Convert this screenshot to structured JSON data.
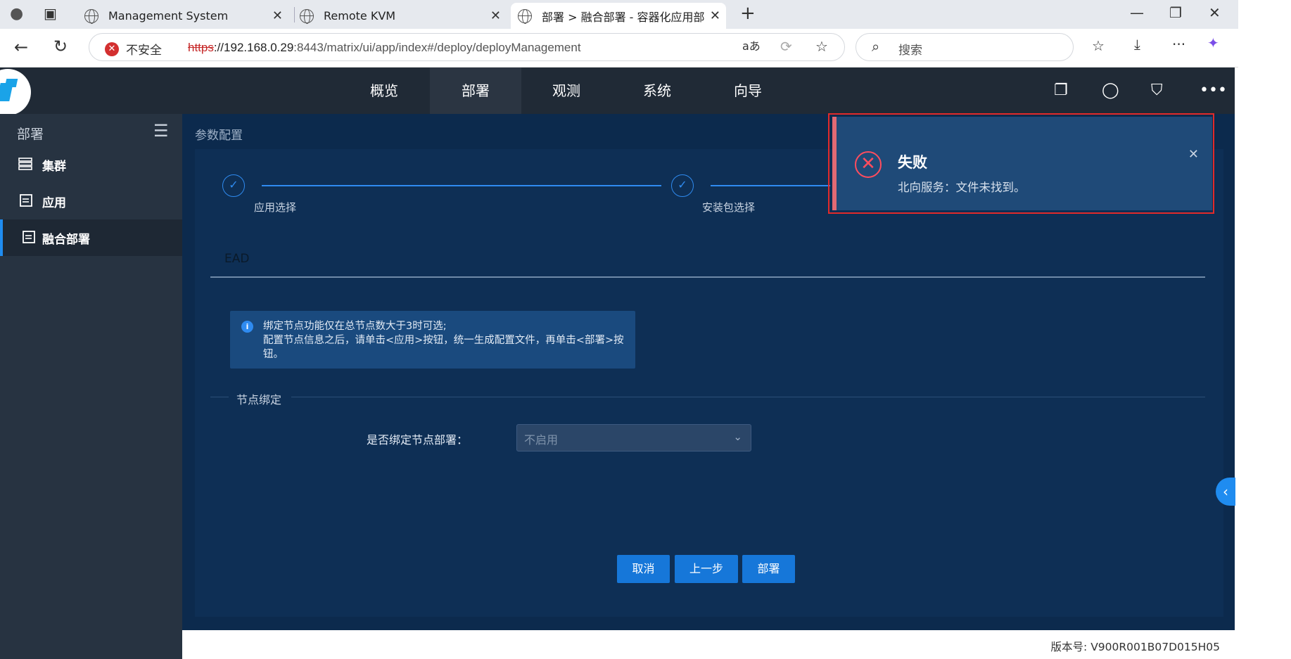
{
  "browser": {
    "tabs": [
      {
        "title": "Management System"
      },
      {
        "title": "Remote KVM"
      },
      {
        "title": "部署 > 融合部署 - 容器化应用部署"
      }
    ],
    "insecure_label": "不安全",
    "url_scheme": "https",
    "url_host": "://192.168.0.29",
    "url_rest": ":8443/matrix/ui/app/index#/deploy/deployManagement",
    "search_placeholder": "搜索"
  },
  "topnav": {
    "items": [
      {
        "label": "概览"
      },
      {
        "label": "部署"
      },
      {
        "label": "观测"
      },
      {
        "label": "系统"
      },
      {
        "label": "向导"
      }
    ]
  },
  "sidebar": {
    "title": "部署",
    "items": [
      {
        "label": "集群"
      },
      {
        "label": "应用"
      },
      {
        "label": "融合部署"
      }
    ]
  },
  "main": {
    "breadcrumb": "参数配置",
    "steps": [
      {
        "label": "应用选择",
        "icon": "check-icon"
      },
      {
        "label": "安装包选择",
        "icon": "check-icon"
      }
    ],
    "tab": "EAD",
    "info": {
      "line1": "绑定节点功能仅在总节点数大于3时可选;",
      "line2": "配置节点信息之后，请单击<应用>按钮，统一生成配置文件，再单击<部署>按钮。"
    },
    "section_title": "节点绑定",
    "field_label": "是否绑定节点部署：",
    "select_value": "不启用",
    "buttons": {
      "cancel": "取消",
      "prev": "上一步",
      "deploy": "部署"
    }
  },
  "toast": {
    "title": "失败",
    "message": "北向服务：文件未找到。"
  },
  "footer": {
    "version": "版本号: V900R001B07D015H05"
  },
  "colors": {
    "accent": "#1677d9",
    "error": "#ff4d5e",
    "nav_bg": "#202a36",
    "content_bg": "#0c2a4d"
  }
}
